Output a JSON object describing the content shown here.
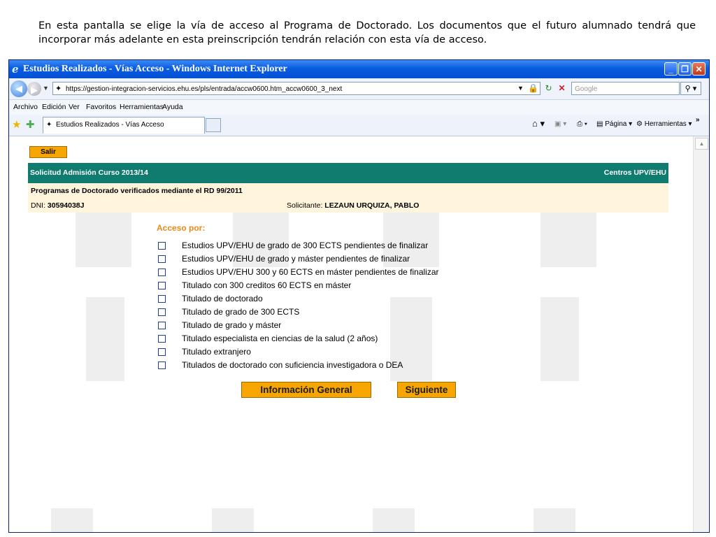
{
  "caption": "En esta pantalla se elige la vía de acceso al Programa de Doctorado. Los documentos que el futuro alumnado tendrá que incorporar más adelante en esta preinscripción tendrán relación con esta vía de acceso.",
  "window": {
    "title": "Estudios Realizados - Vías Acceso - Windows Internet Explorer",
    "url": "https://gestion-integracion-servicios.ehu.es/pls/entrada/accw0600.htm_accw0600_3_next",
    "search_placeholder": "Google"
  },
  "menu": [
    "Archivo",
    "Edición",
    "Ver",
    "Favoritos",
    "Herramientas",
    "Ayuda"
  ],
  "tab": {
    "label": "Estudios Realizados - Vías Acceso"
  },
  "toolbar": {
    "pagina": "Página",
    "herramientas": "Herramientas"
  },
  "page": {
    "salir": "Salir",
    "header_left": "Solicitud Admisión Curso 2013/14",
    "header_right": "Centros UPV/EHU",
    "programa": "Programas de Doctorado verificados mediante el RD 99/2011",
    "dni_label": "DNI:",
    "dni_value": "30594038J",
    "solicitante_label": "Solicitante:",
    "solicitante_value": "LEZAUN URQUIZA, PABLO",
    "acceso_label": "Acceso por:",
    "options": [
      "Estudios UPV/EHU de grado de 300 ECTS pendientes de finalizar",
      "Estudios UPV/EHU de grado y máster pendientes de finalizar",
      "Estudios UPV/EHU 300 y 60 ECTS en máster pendientes de finalizar",
      "Titulado con 300 creditos 60 ECTS en máster",
      "Titulado de doctorado",
      "Titulado de grado de 300 ECTS",
      "Titulado de grado y máster",
      "Titulado especialista en ciencias de la salud (2 años)",
      "Titulado extranjero",
      "Titulados de doctorado con suficiencia investigadora o DEA"
    ],
    "info_button": "Información General",
    "next_button": "Siguiente"
  },
  "colors": {
    "header": "#0f7c6f",
    "info_bg": "#fff5dc",
    "accent": "#f7a500",
    "acceso": "#e88a1a"
  }
}
